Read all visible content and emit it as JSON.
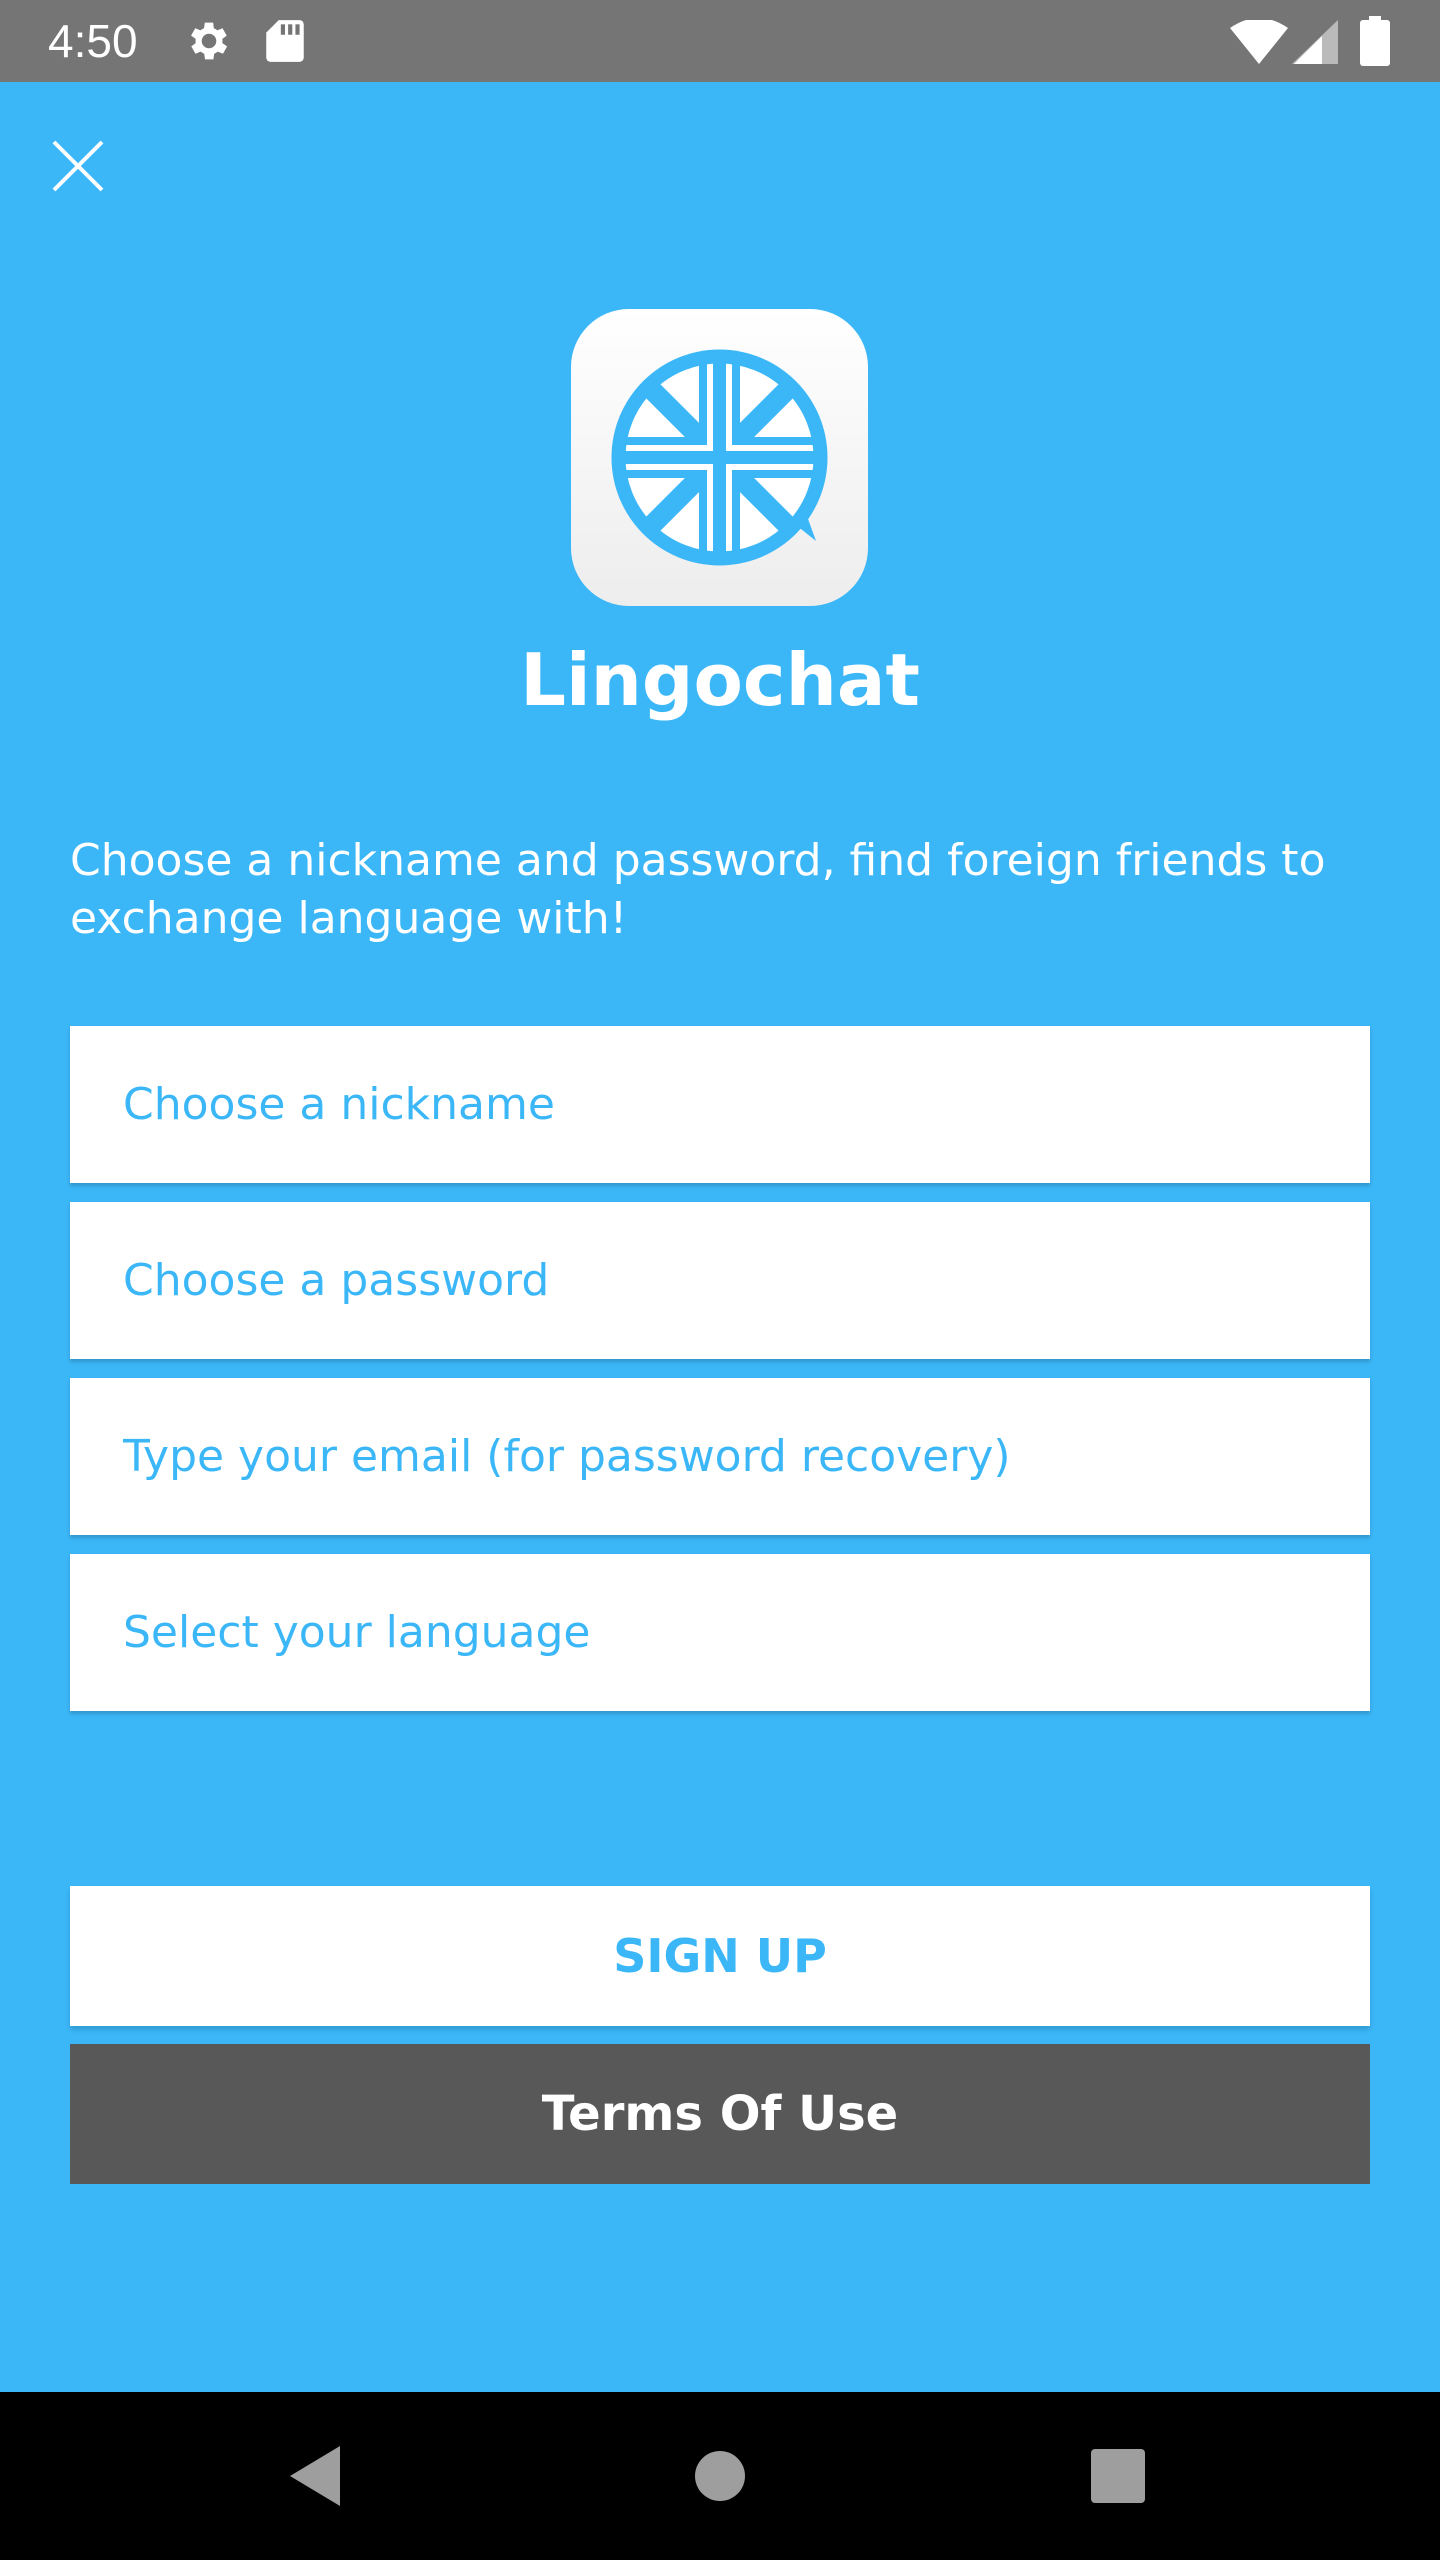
{
  "status_bar": {
    "time": "4:50",
    "icons": [
      "settings-icon",
      "sd-card-icon",
      "wifi-icon",
      "signal-icon",
      "battery-icon"
    ]
  },
  "app": {
    "name": "Lingochat",
    "logo": "globe-chat-bubble-logo"
  },
  "intro_text": "Choose a nickname and password, find foreign friends to exchange language with!",
  "form": {
    "nickname_placeholder": "Choose a nickname",
    "password_placeholder": "Choose a password",
    "email_placeholder": "Type your email (for password recovery)",
    "language_label": "Select your language"
  },
  "buttons": {
    "signup_label": "SIGN UP",
    "terms_label": "Terms Of Use"
  },
  "colors": {
    "background": "#3bb7f8",
    "accent": "#3bb7f8",
    "terms_button": "#585858",
    "status_bar": "#757575",
    "nav_bar": "#000000"
  },
  "navigation": {
    "icons": [
      "back-icon",
      "home-icon",
      "recents-icon"
    ]
  }
}
